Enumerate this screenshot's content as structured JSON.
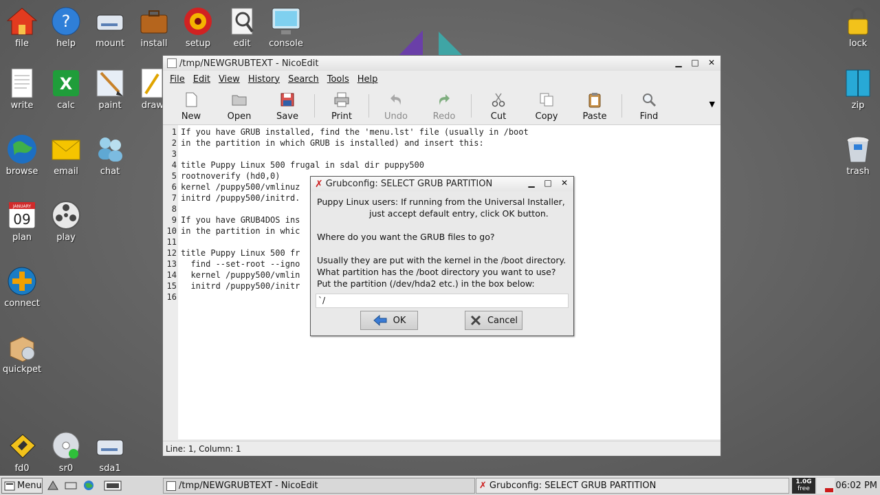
{
  "desktop": {
    "left_icons": [
      {
        "label": "file",
        "icon": "home-icon"
      },
      {
        "label": "help",
        "icon": "help-icon"
      },
      {
        "label": "mount",
        "icon": "drive-icon"
      },
      {
        "label": "install",
        "icon": "briefcase-icon"
      },
      {
        "label": "setup",
        "icon": "setup-icon"
      },
      {
        "label": "edit",
        "icon": "edit-icon"
      },
      {
        "label": "console",
        "icon": "console-icon"
      },
      {
        "label": "write",
        "icon": "document-icon"
      },
      {
        "label": "calc",
        "icon": "spreadsheet-icon"
      },
      {
        "label": "paint",
        "icon": "paint-icon"
      },
      {
        "label": "draw",
        "icon": "draw-icon"
      },
      {
        "label": "browse",
        "icon": "globe-icon"
      },
      {
        "label": "email",
        "icon": "email-icon"
      },
      {
        "label": "chat",
        "icon": "chat-icon"
      },
      {
        "label": "plan",
        "icon": "calendar-icon"
      },
      {
        "label": "play",
        "icon": "film-reel-icon"
      },
      {
        "label": "connect",
        "icon": "connect-icon"
      },
      {
        "label": "quickpet",
        "icon": "package-icon"
      },
      {
        "label": "fd0",
        "icon": "floppy-icon"
      },
      {
        "label": "sr0",
        "icon": "cdrom-icon"
      },
      {
        "label": "sda1",
        "icon": "hard-drive-icon"
      }
    ],
    "right_icons": [
      {
        "label": "lock",
        "icon": "padlock-icon"
      },
      {
        "label": "zip",
        "icon": "archive-icon"
      },
      {
        "label": "trash",
        "icon": "trash-icon"
      }
    ],
    "calendar_day": "09",
    "calendar_month": "JANUARY"
  },
  "editor": {
    "title": "/tmp/NEWGRUBTEXT - NicoEdit",
    "menu": [
      "File",
      "Edit",
      "View",
      "History",
      "Search",
      "Tools",
      "Help"
    ],
    "toolbar": [
      {
        "label": "New",
        "icon": "new-file-icon",
        "enabled": true
      },
      {
        "label": "Open",
        "icon": "folder-icon",
        "enabled": true
      },
      {
        "label": "Save",
        "icon": "floppy-save-icon",
        "enabled": true
      },
      {
        "label": "Print",
        "icon": "printer-icon",
        "enabled": true
      },
      {
        "label": "Undo",
        "icon": "undo-icon",
        "enabled": false
      },
      {
        "label": "Redo",
        "icon": "redo-icon",
        "enabled": false
      },
      {
        "label": "Cut",
        "icon": "scissors-icon",
        "enabled": true
      },
      {
        "label": "Copy",
        "icon": "copy-icon",
        "enabled": true
      },
      {
        "label": "Paste",
        "icon": "clipboard-icon",
        "enabled": true
      },
      {
        "label": "Find",
        "icon": "magnifier-icon",
        "enabled": true
      }
    ],
    "lines": [
      {
        "n": "1",
        "text": "If you have GRUB installed, find the 'menu.lst' file (usually in /boot"
      },
      {
        "n": "2",
        "text": "in the partition in which GRUB is installed) and insert this:"
      },
      {
        "n": "3",
        "text": ""
      },
      {
        "n": "4",
        "text": "title Puppy Linux 500 frugal in sdal dir puppy500"
      },
      {
        "n": "5",
        "text": "rootnoverify (hd0,0)"
      },
      {
        "n": "6",
        "text": "kernel /puppy500/vmlinuz"
      },
      {
        "n": "7",
        "text": "initrd /puppy500/initrd."
      },
      {
        "n": "8",
        "text": ""
      },
      {
        "n": "9",
        "text": "If you have GRUB4DOS ins"
      },
      {
        "n": "10",
        "text": "in the partition in whic"
      },
      {
        "n": "11",
        "text": ""
      },
      {
        "n": "12",
        "text": "title Puppy Linux 500 fr"
      },
      {
        "n": "13",
        "text": "  find --set-root --igno"
      },
      {
        "n": "14",
        "text": "  kernel /puppy500/vmlin"
      },
      {
        "n": "15",
        "text": "  initrd /puppy500/initr"
      },
      {
        "n": "16",
        "text": ""
      }
    ],
    "status": "Line: 1, Column: 1"
  },
  "dialog": {
    "title": "Grubconfig: SELECT GRUB PARTITION",
    "text_lines": [
      "Puppy Linux users: If running from the Universal Installer,",
      "just accept default entry, click OK button.",
      "Where do you want the GRUB files to go?",
      "Usually they are put with the kernel in the /boot directory.",
      "What partition has the /boot directory you want to use?",
      "Put the partition (/dev/hda2 etc.) in the box below:"
    ],
    "input_value": "`/",
    "ok_label": "OK",
    "cancel_label": "Cancel"
  },
  "taskbar": {
    "menu_label": "Menu",
    "tasks": [
      {
        "label": "/tmp/NEWGRUBTEXT - NicoEdit"
      },
      {
        "label": "Grubconfig: SELECT GRUB PARTITION"
      }
    ],
    "free_space": "1.0G",
    "free_label": "free",
    "clock": "06:02 PM"
  },
  "colors": {
    "accent_red": "#cc1b1b",
    "taskbar": "#d8d8d8",
    "desktop": "#676767"
  }
}
